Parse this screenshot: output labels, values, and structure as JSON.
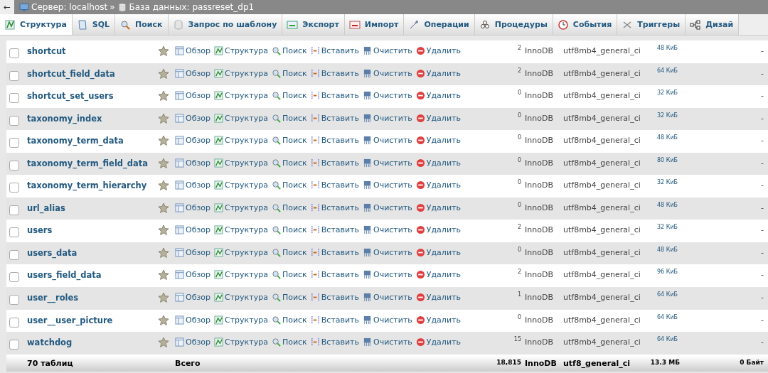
{
  "breadcrumb": {
    "back": "←",
    "server": "Сервер: localhost",
    "separator": "»",
    "database": "База данных: passreset_dp1"
  },
  "tabs": [
    {
      "label": "Структура",
      "selected": true
    },
    {
      "label": "SQL",
      "selected": false
    },
    {
      "label": "Поиск",
      "selected": false
    },
    {
      "label": "Запрос по шаблону",
      "selected": false
    },
    {
      "label": "Экспорт",
      "selected": false
    },
    {
      "label": "Импорт",
      "selected": false
    },
    {
      "label": "Операции",
      "selected": false
    },
    {
      "label": "Процедуры",
      "selected": false
    },
    {
      "label": "События",
      "selected": false
    },
    {
      "label": "Триггеры",
      "selected": false
    },
    {
      "label": "Дизай",
      "selected": false
    }
  ],
  "rows": [
    {
      "name": "shortcut",
      "checked": false,
      "actions": [
        "Обзор",
        "Структура",
        "Поиск",
        "Вставить",
        "Очистить",
        "Удалить"
      ],
      "count": "2",
      "engine": "InnoDB",
      "collation": "utf8mb4_general_ci",
      "size": "48 КиБ",
      "overhead": "-"
    },
    {
      "name": "shortcut_field_data",
      "checked": false,
      "actions": [
        "Обзор",
        "Структура",
        "Поиск",
        "Вставить",
        "Очистить",
        "Удалить"
      ],
      "count": "2",
      "engine": "InnoDB",
      "collation": "utf8mb4_general_ci",
      "size": "64 КиБ",
      "overhead": "-"
    },
    {
      "name": "shortcut_set_users",
      "checked": false,
      "actions": [
        "Обзор",
        "Структура",
        "Поиск",
        "Вставить",
        "Очистить",
        "Удалить"
      ],
      "count": "0",
      "engine": "InnoDB",
      "collation": "utf8mb4_general_ci",
      "size": "32 КиБ",
      "overhead": "-"
    },
    {
      "name": "taxonomy_index",
      "checked": false,
      "actions": [
        "Обзор",
        "Структура",
        "Поиск",
        "Вставить",
        "Очистить",
        "Удалить"
      ],
      "count": "0",
      "engine": "InnoDB",
      "collation": "utf8mb4_general_ci",
      "size": "32 КиБ",
      "overhead": "-"
    },
    {
      "name": "taxonomy_term_data",
      "checked": false,
      "actions": [
        "Обзор",
        "Структура",
        "Поиск",
        "Вставить",
        "Очистить",
        "Удалить"
      ],
      "count": "0",
      "engine": "InnoDB",
      "collation": "utf8mb4_general_ci",
      "size": "48 КиБ",
      "overhead": "-"
    },
    {
      "name": "taxonomy_term_field_data",
      "checked": false,
      "actions": [
        "Обзор",
        "Структура",
        "Поиск",
        "Вставить",
        "Очистить",
        "Удалить"
      ],
      "count": "0",
      "engine": "InnoDB",
      "collation": "utf8mb4_general_ci",
      "size": "80 КиБ",
      "overhead": "-"
    },
    {
      "name": "taxonomy_term_hierarchy",
      "checked": false,
      "actions": [
        "Обзор",
        "Структура",
        "Поиск",
        "Вставить",
        "Очистить",
        "Удалить"
      ],
      "count": "0",
      "engine": "InnoDB",
      "collation": "utf8mb4_general_ci",
      "size": "32 КиБ",
      "overhead": "-"
    },
    {
      "name": "url_alias",
      "checked": false,
      "actions": [
        "Обзор",
        "Структура",
        "Поиск",
        "Вставить",
        "Очистить",
        "Удалить"
      ],
      "count": "0",
      "engine": "InnoDB",
      "collation": "utf8mb4_general_ci",
      "size": "48 КиБ",
      "overhead": "-"
    },
    {
      "name": "users",
      "checked": false,
      "actions": [
        "Обзор",
        "Структура",
        "Поиск",
        "Вставить",
        "Очистить",
        "Удалить"
      ],
      "count": "2",
      "engine": "InnoDB",
      "collation": "utf8mb4_general_ci",
      "size": "32 КиБ",
      "overhead": "-"
    },
    {
      "name": "users_data",
      "checked": false,
      "actions": [
        "Обзор",
        "Структура",
        "Поиск",
        "Вставить",
        "Очистить",
        "Удалить"
      ],
      "count": "0",
      "engine": "InnoDB",
      "collation": "utf8mb4_general_ci",
      "size": "48 КиБ",
      "overhead": "-"
    },
    {
      "name": "users_field_data",
      "checked": false,
      "actions": [
        "Обзор",
        "Структура",
        "Поиск",
        "Вставить",
        "Очистить",
        "Удалить"
      ],
      "count": "2",
      "engine": "InnoDB",
      "collation": "utf8mb4_general_ci",
      "size": "96 КиБ",
      "overhead": "-"
    },
    {
      "name": "user__roles",
      "checked": false,
      "actions": [
        "Обзор",
        "Структура",
        "Поиск",
        "Вставить",
        "Очистить",
        "Удалить"
      ],
      "count": "1",
      "engine": "InnoDB",
      "collation": "utf8mb4_general_ci",
      "size": "64 КиБ",
      "overhead": "-"
    },
    {
      "name": "user__user_picture",
      "checked": false,
      "actions": [
        "Обзор",
        "Структура",
        "Поиск",
        "Вставить",
        "Очистить",
        "Удалить"
      ],
      "count": "0",
      "engine": "InnoDB",
      "collation": "utf8mb4_general_ci",
      "size": "64 КиБ",
      "overhead": "-"
    },
    {
      "name": "watchdog",
      "checked": false,
      "actions": [
        "Обзор",
        "Структура",
        "Поиск",
        "Вставить",
        "Очистить",
        "Удалить"
      ],
      "count": "15",
      "engine": "InnoDB",
      "collation": "utf8mb4_general_ci",
      "size": "64 КиБ",
      "overhead": "-"
    }
  ],
  "footer": {
    "tables": "70 таблиц",
    "total": "Всего",
    "count": "18,815",
    "engine": "InnoDB",
    "collation": "utf8_general_ci",
    "size": "13.3 МБ",
    "overhead": "0 Байт"
  }
}
